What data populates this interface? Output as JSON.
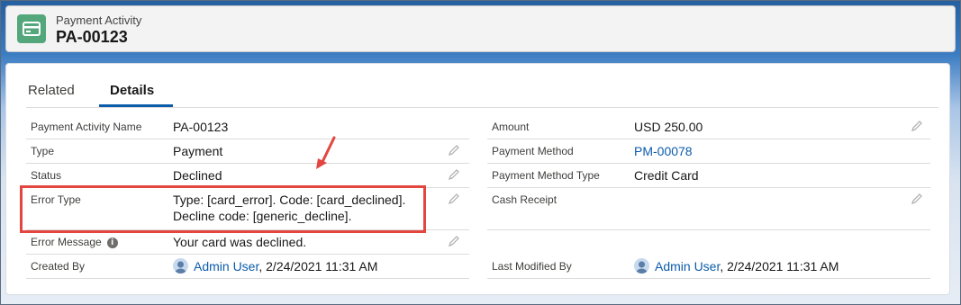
{
  "header": {
    "object_type": "Payment Activity",
    "record_name": "PA-00123",
    "icon": "payment-card-icon",
    "icon_color": "#54a77b"
  },
  "tabs": [
    {
      "label": "Related",
      "active": false
    },
    {
      "label": "Details",
      "active": true
    }
  ],
  "details": {
    "left": [
      {
        "label": "Payment Activity Name",
        "value": "PA-00123"
      },
      {
        "label": "Type",
        "value": "Payment"
      },
      {
        "label": "Status",
        "value": "Declined"
      },
      {
        "label": "Error Type",
        "value_line1": "Type: [card_error]. Code: [card_declined].",
        "value_line2": "Decline code: [generic_decline]."
      },
      {
        "label": "Error Message",
        "value": "Your card was declined."
      },
      {
        "label": "Created By",
        "user": "Admin User",
        "timestamp": ", 2/24/2021 11:31 AM"
      }
    ],
    "right": [
      {
        "label": "Amount",
        "value": "USD 250.00"
      },
      {
        "label": "Payment Method",
        "value": "PM-00078"
      },
      {
        "label": "Payment Method Type",
        "value": "Credit Card"
      },
      {
        "label": "Cash Receipt",
        "value": ""
      },
      {
        "label": "Last Modified By",
        "user": "Admin User",
        "timestamp": ", 2/24/2021 11:31 AM"
      }
    ]
  },
  "colors": {
    "accent": "#0b5cab",
    "highlight": "#e2463f"
  }
}
